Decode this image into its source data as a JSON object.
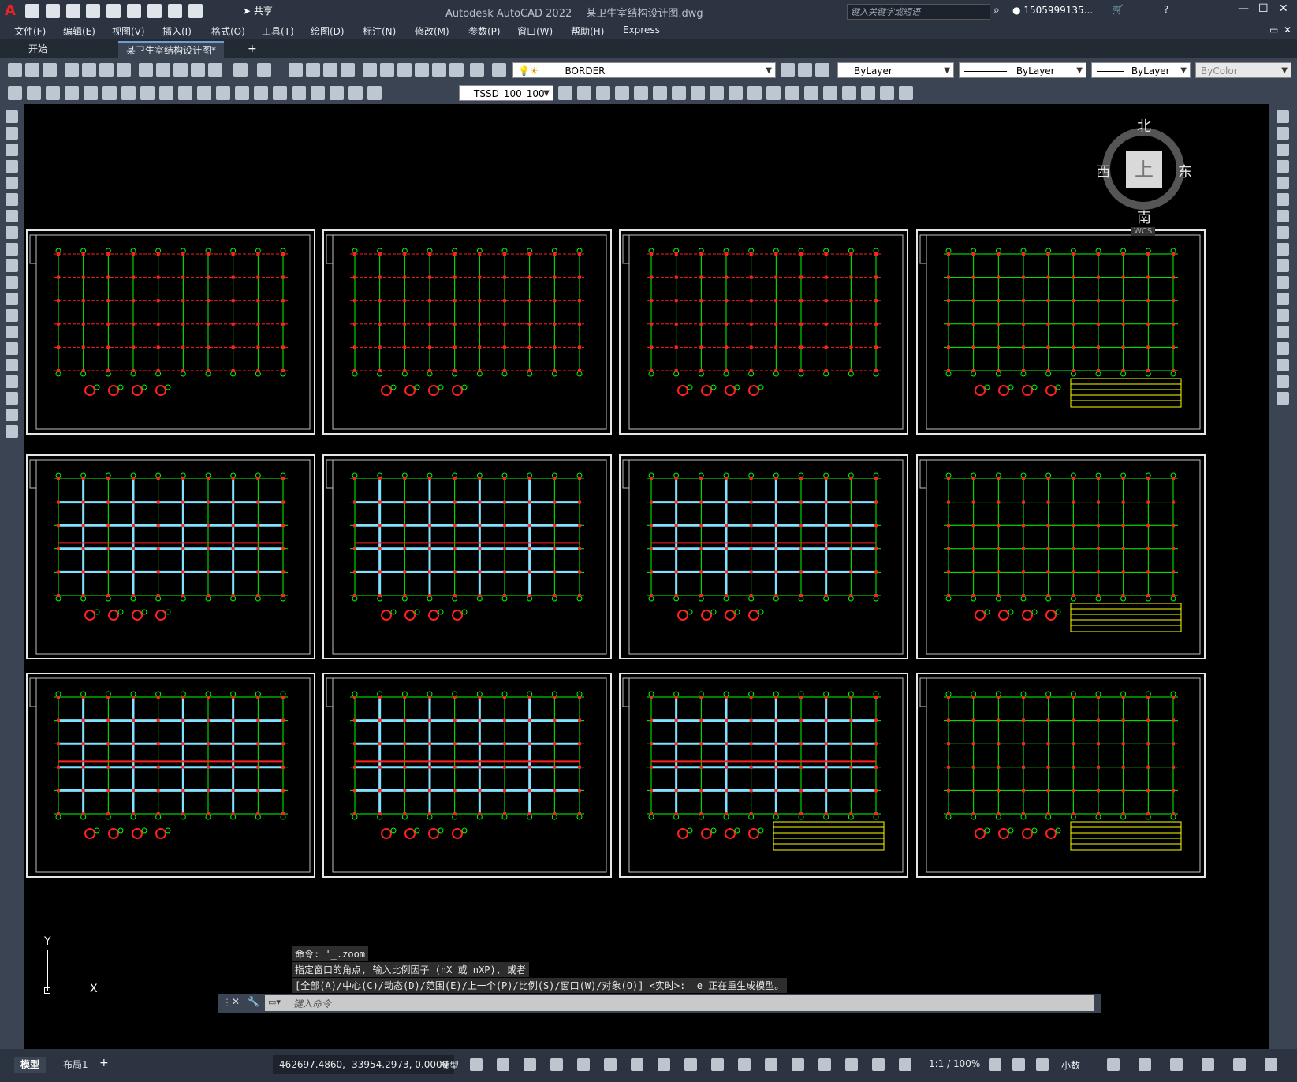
{
  "titlebar": {
    "app_title": "Autodesk AutoCAD 2022",
    "file_name": "某卫生室结构设计图.dwg",
    "share_label": "共享",
    "search_placeholder": "键入关键字或短语",
    "user_name": "1505999135..."
  },
  "menubar": {
    "items": [
      "文件(F)",
      "编辑(E)",
      "视图(V)",
      "插入(I)",
      "格式(O)",
      "工具(T)",
      "绘图(D)",
      "标注(N)",
      "修改(M)",
      "参数(P)",
      "窗口(W)",
      "帮助(H)",
      "Express"
    ]
  },
  "tabs": {
    "items": [
      "开始",
      "某卫生室结构设计图*"
    ],
    "active": 1
  },
  "ribbon": {
    "layer_name": "BORDER",
    "color_value": "ByLayer",
    "linetype_value": "ByLayer",
    "lineweight_value": "ByLayer",
    "plotstyle_value": "ByColor",
    "dimstyle_value": "TSSD_100_100"
  },
  "viewcube": {
    "north": "北",
    "south": "南",
    "east": "东",
    "west": "西",
    "face": "上",
    "wcs": "WCS"
  },
  "command": {
    "history": [
      "命令: '_.zoom",
      "指定窗口的角点, 输入比例因子 (nX 或 nXP), 或者",
      "[全部(A)/中心(C)/动态(D)/范围(E)/上一个(P)/比例(S)/窗口(W)/对象(O)] <实时>: _e 正在重生成模型。"
    ],
    "placeholder": "键入命令"
  },
  "ucs": {
    "x_label": "X",
    "y_label": "Y"
  },
  "statusbar": {
    "layout_tabs": [
      "模型",
      "布局1"
    ],
    "coordinates": "462697.4860, -33954.2973, 0.0000",
    "space_label": "模型",
    "scale_label": "1:1 / 100%",
    "units_label": "小数"
  },
  "colors": {
    "accent": "#6a9fd8",
    "grid_green": "#00ff00",
    "rebar_red": "#ff2020",
    "wall_cyan": "#7fe3ff",
    "frame_white": "#e6e6e6",
    "table_yellow": "#ffff00"
  }
}
